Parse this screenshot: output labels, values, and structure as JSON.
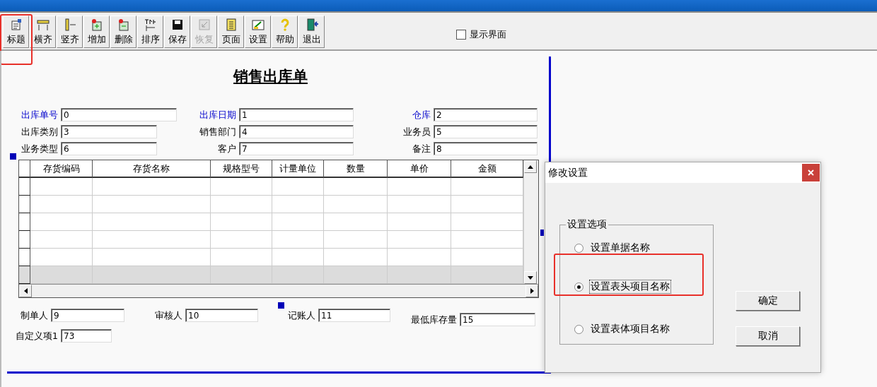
{
  "toolbar": {
    "buttons": [
      {
        "label": "标题",
        "disabled": false,
        "highlighted": true
      },
      {
        "label": "横齐",
        "disabled": false,
        "highlighted": false
      },
      {
        "label": "竖齐",
        "disabled": false,
        "highlighted": false
      },
      {
        "label": "增加",
        "disabled": false,
        "highlighted": false
      },
      {
        "label": "删除",
        "disabled": false,
        "highlighted": false
      },
      {
        "label": "排序",
        "disabled": false,
        "highlighted": false
      },
      {
        "label": "保存",
        "disabled": false,
        "highlighted": false
      },
      {
        "label": "恢复",
        "disabled": true,
        "highlighted": false
      },
      {
        "label": "页面",
        "disabled": false,
        "highlighted": false
      },
      {
        "label": "设置",
        "disabled": false,
        "highlighted": false
      },
      {
        "label": "帮助",
        "disabled": false,
        "highlighted": false
      },
      {
        "label": "退出",
        "disabled": false,
        "highlighted": false
      }
    ],
    "show_ui": {
      "label": "显示界面",
      "checked": false
    }
  },
  "form": {
    "title": "销售出库单",
    "header_fields": [
      {
        "label": "出库单号",
        "value": "0",
        "emphasized": true
      },
      {
        "label": "出库日期",
        "value": "1",
        "emphasized": true
      },
      {
        "label": "仓库",
        "value": "2",
        "emphasized": true
      },
      {
        "label": "出库类别",
        "value": "3",
        "emphasized": false
      },
      {
        "label": "销售部门",
        "value": "4",
        "emphasized": false
      },
      {
        "label": "业务员",
        "value": "5",
        "emphasized": false
      },
      {
        "label": "业务类型",
        "value": "6",
        "emphasized": false
      },
      {
        "label": "客户",
        "value": "7",
        "emphasized": false
      },
      {
        "label": "备注",
        "value": "8",
        "emphasized": false
      }
    ],
    "grid": {
      "columns": [
        "存货编码",
        "存货名称",
        "规格型号",
        "计量单位",
        "数量",
        "单价",
        "金额"
      ],
      "rows": [
        {
          "selected": false
        },
        {
          "selected": false
        },
        {
          "selected": false
        },
        {
          "selected": false
        },
        {
          "selected": false
        },
        {
          "selected": true
        }
      ]
    },
    "footer_fields": [
      {
        "label": "制单人",
        "value": "9"
      },
      {
        "label": "审核人",
        "value": "10"
      },
      {
        "label": "记账人",
        "value": "11"
      },
      {
        "label": "最低库存量",
        "value": "15"
      },
      {
        "label": "自定义项1",
        "value": "73"
      }
    ]
  },
  "dialog": {
    "title": "修改设置",
    "group_label": "设置选项",
    "options": [
      {
        "label": "设置单据名称",
        "selected": false,
        "highlighted": false
      },
      {
        "label": "设置表头项目名称",
        "selected": true,
        "highlighted": true
      },
      {
        "label": "设置表体项目名称",
        "selected": false,
        "highlighted": false
      }
    ],
    "buttons": [
      "确定",
      "取消"
    ]
  }
}
